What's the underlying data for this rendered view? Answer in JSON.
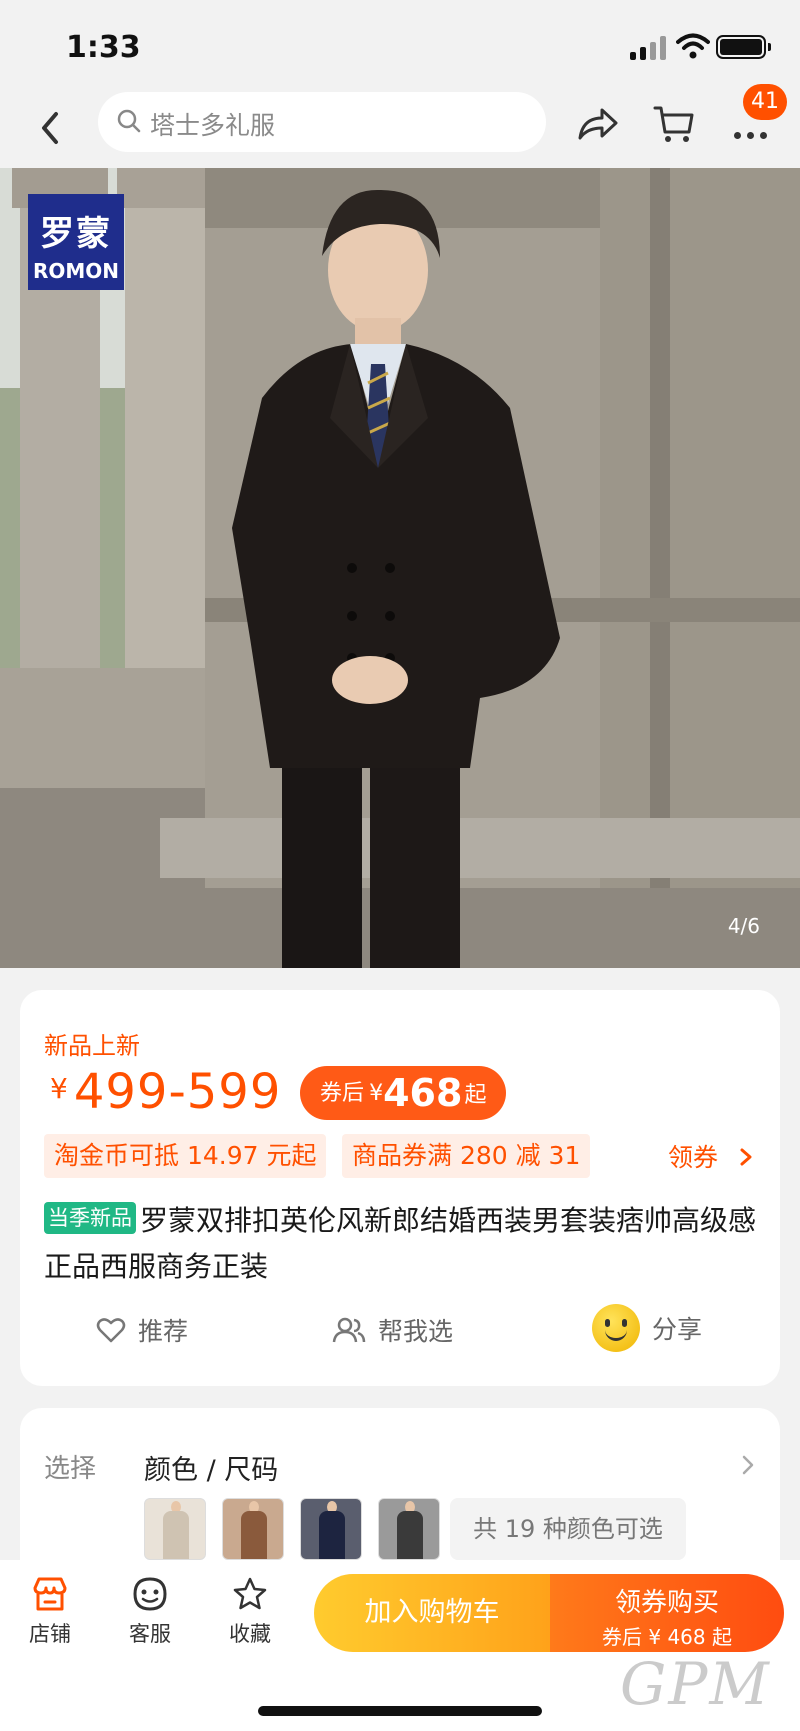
{
  "status_bar": {
    "time": "1:33"
  },
  "nav": {
    "search_placeholder": "塔士多礼服",
    "badge_count": "41",
    "icons": [
      "back-icon",
      "search-icon",
      "share-icon",
      "cart-icon",
      "more-icon"
    ]
  },
  "hero": {
    "brand_cn": "罗蒙",
    "brand_en": "ROMON",
    "pager": "4/6"
  },
  "product": {
    "new_tag": "新品上新",
    "price_currency": "¥",
    "price_range": "499-599",
    "after_coupon_label": "券后",
    "after_coupon_currency": "¥",
    "after_coupon_price": "468",
    "after_coupon_suffix": "起",
    "chip_coins": "淘金币可抵 14.97 元起",
    "chip_coupon": "商品券满 280 减 31",
    "get_coupon": "领券",
    "season_tag": "当季新品",
    "title": "罗蒙双排扣英伦风新郎结婚西装男套装痞帅高级感正品西服商务正装"
  },
  "actions": {
    "recommend": "推荐",
    "help_choose": "帮我选",
    "share": "分享"
  },
  "selection": {
    "label": "选择",
    "value": "颜色 / 尺码",
    "more_colors": "共 19 种颜色可选"
  },
  "bottom_bar": {
    "store": "店铺",
    "service": "客服",
    "favorite": "收藏",
    "add_to_cart": "加入购物车",
    "buy_label": "领券购买",
    "buy_sub": "券后 ¥ 468 起"
  },
  "watermark": "GPM",
  "colors": {
    "accent": "#ff5000",
    "cart_button": "#ffb020",
    "buy_button": "#ff5a16",
    "season_tag": "#20b885",
    "brand_logo": "#1f2d8c"
  }
}
